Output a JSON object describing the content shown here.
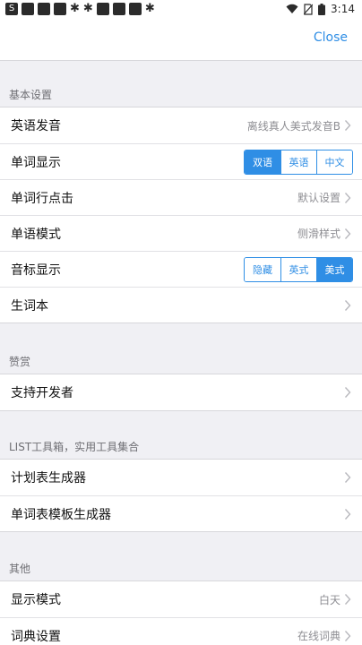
{
  "status_bar": {
    "time": "3:14"
  },
  "nav": {
    "close_label": "Close"
  },
  "sections": {
    "basic": {
      "header": "基本设置",
      "rows": {
        "pronunciation": {
          "label": "英语发音",
          "value": "离线真人美式发音B"
        },
        "word_display": {
          "label": "单词显示",
          "options": [
            "双语",
            "英语",
            "中文"
          ],
          "selected": "双语"
        },
        "word_row_click": {
          "label": "单词行点击",
          "value": "默认设置"
        },
        "word_mode": {
          "label": "单语模式",
          "value": "侧滑样式"
        },
        "phonetic_display": {
          "label": "音标显示",
          "options": [
            "隐藏",
            "英式",
            "美式"
          ],
          "selected": "美式"
        },
        "vocab_book": {
          "label": "生词本"
        }
      }
    },
    "reward": {
      "header": "赞赏",
      "rows": {
        "support_dev": {
          "label": "支持开发者"
        }
      }
    },
    "tools": {
      "header": "LIST工具箱，实用工具集合",
      "rows": {
        "plan_generator": {
          "label": "计划表生成器"
        },
        "wordlist_template": {
          "label": "单词表模板生成器"
        }
      }
    },
    "other": {
      "header": "其他",
      "rows": {
        "display_mode": {
          "label": "显示模式",
          "value": "白天"
        },
        "dictionary": {
          "label": "词典设置",
          "value": "在线词典"
        }
      }
    }
  },
  "colors": {
    "accent": "#2f8ee5",
    "background": "#f0f0f4",
    "secondary_text": "#8e8e93"
  },
  "icons": [
    "sb-app-icon",
    "wifi-icon",
    "no-sim-icon",
    "battery-icon",
    "chevron-right-icon"
  ]
}
